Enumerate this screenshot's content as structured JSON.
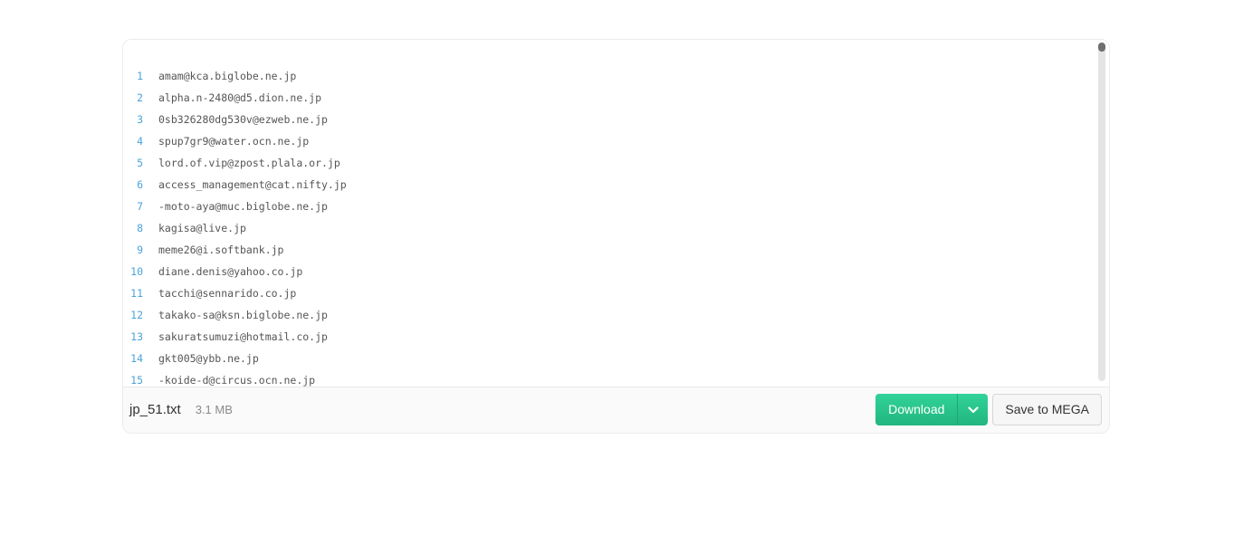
{
  "file": {
    "name": "jp_51.txt",
    "size": "3.1 MB"
  },
  "lines": [
    {
      "n": "1",
      "text": "amam@kca.biglobe.ne.jp"
    },
    {
      "n": "2",
      "text": "alpha.n-2480@d5.dion.ne.jp"
    },
    {
      "n": "3",
      "text": "0sb326280dg530v@ezweb.ne.jp"
    },
    {
      "n": "4",
      "text": "spup7gr9@water.ocn.ne.jp"
    },
    {
      "n": "5",
      "text": "lord.of.vip@zpost.plala.or.jp"
    },
    {
      "n": "6",
      "text": "access_management@cat.nifty.jp"
    },
    {
      "n": "7",
      "text": "-moto-aya@muc.biglobe.ne.jp"
    },
    {
      "n": "8",
      "text": "kagisa@live.jp"
    },
    {
      "n": "9",
      "text": "meme26@i.softbank.jp"
    },
    {
      "n": "10",
      "text": "diane.denis@yahoo.co.jp"
    },
    {
      "n": "11",
      "text": "tacchi@sennarido.co.jp"
    },
    {
      "n": "12",
      "text": "takako-sa@ksn.biglobe.ne.jp"
    },
    {
      "n": "13",
      "text": "sakuratsumuzi@hotmail.co.jp"
    },
    {
      "n": "14",
      "text": "gkt005@ybb.ne.jp"
    },
    {
      "n": "15",
      "text": "-koide-d@circus.ocn.ne.jp"
    }
  ],
  "actions": {
    "download_label": "Download",
    "download_options_icon": "chevron-down-icon",
    "save_label": "Save to MEGA"
  },
  "colors": {
    "accent": "#2bc48d",
    "line_number": "#4aa3d8"
  }
}
